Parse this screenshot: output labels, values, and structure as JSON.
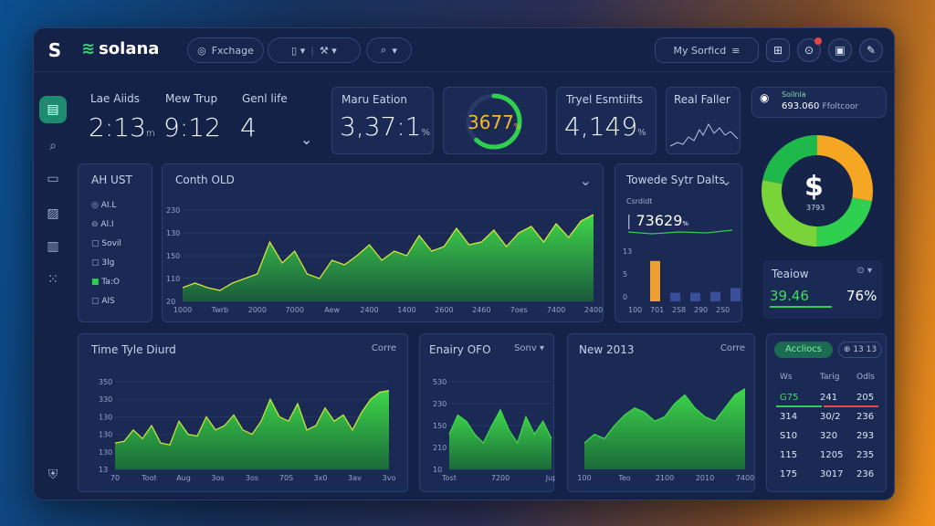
{
  "topbar": {
    "brand": "solana",
    "exchange_label": "Fxchage",
    "search_placeholder": "Q",
    "account_label": "My Sorficd"
  },
  "stats": [
    {
      "label": "Lae Aiids",
      "value": "2:13",
      "suffix": "m"
    },
    {
      "label": "Mew Trup",
      "value": "9:12"
    },
    {
      "label": "Genl life",
      "value": "4"
    }
  ],
  "market_cap": {
    "label": "Maru Eation",
    "value": "3,37:1",
    "suffix": "%"
  },
  "gauge": {
    "value": "3677",
    "suffix": "%",
    "progress": 0.62
  },
  "total": {
    "label": "Tryel Esmtiifts",
    "value": "4,149",
    "suffix": "%"
  },
  "real": {
    "label": "Real Faller"
  },
  "sol_chip": {
    "title": "Soilnla",
    "value": "693.060",
    "note": "Ffoltcoor"
  },
  "donut": {
    "symbol": "$",
    "value": "3793",
    "segments": [
      {
        "color": "#f5a623",
        "share": 0.28
      },
      {
        "color": "#2fcf4f",
        "share": 0.22
      },
      {
        "color": "#79d43a",
        "share": 0.28
      },
      {
        "color": "#1fb84a",
        "share": 0.22
      }
    ]
  },
  "list": {
    "title": "AH UST",
    "items": [
      {
        "icon": "radio-icon",
        "label": "AI.L"
      },
      {
        "icon": "toggle-icon",
        "label": "Al.I"
      },
      {
        "icon": "box-icon",
        "label": "Sovil"
      },
      {
        "icon": "box-icon",
        "label": "3lg"
      },
      {
        "icon": "active-box-icon",
        "label": "Ta:O"
      },
      {
        "icon": "box-icon",
        "label": "AlS"
      }
    ]
  },
  "main_chart": {
    "title": "Conth OLD",
    "yticks": [
      "230",
      "130",
      "150",
      "110",
      "20"
    ],
    "xticks": [
      "1000",
      "Twrb",
      "2000",
      "7000",
      "Aew",
      "2400",
      "1400",
      "2600",
      "2460",
      "7oes",
      "7400",
      "2400"
    ]
  },
  "sidechart": {
    "title": "Towede Sytr Dalts",
    "sub": "Csrdidt",
    "value": "73629",
    "suffix": "%",
    "yticks": [
      "13",
      "5",
      "0"
    ],
    "xticks": [
      "100",
      "701",
      "2S8",
      "290",
      "2S0"
    ],
    "bars": [
      0.85,
      0.18,
      0.18,
      0.2,
      0.28
    ]
  },
  "teaiow": {
    "title": "Teaiow",
    "value": "39.46",
    "pct": "76%"
  },
  "time_chart": {
    "title": "Time Tyle Diurd",
    "action": "Corre",
    "yticks": [
      "350",
      "330",
      "130",
      "130",
      "130",
      "13"
    ],
    "xticks": [
      "70",
      "Toot",
      "Aug",
      "3os",
      "3os",
      "70S",
      "3x0",
      "3av",
      "3vo"
    ]
  },
  "energy_chart": {
    "title": "Enairy OFO",
    "action": "Sonv",
    "yticks": [
      "530",
      "230",
      "150",
      "210",
      "10"
    ],
    "xticks": [
      "Tost",
      "7200",
      "Jup"
    ]
  },
  "new_chart": {
    "title": "New 2013",
    "action": "Corre",
    "xticks": [
      "100",
      "Teo",
      "2100",
      "2010",
      "7400"
    ]
  },
  "table": {
    "tab_active": "Accliocs",
    "tab_other": "13 13",
    "headers": [
      "Ws",
      "Tarig",
      "Odls"
    ],
    "rows": [
      [
        "G75",
        "241",
        "205"
      ],
      [
        "314",
        "30/2",
        "236"
      ],
      [
        "S10",
        "320",
        "293"
      ],
      [
        "115",
        "1205",
        "235"
      ],
      [
        "175",
        "3017",
        "236"
      ]
    ]
  }
}
